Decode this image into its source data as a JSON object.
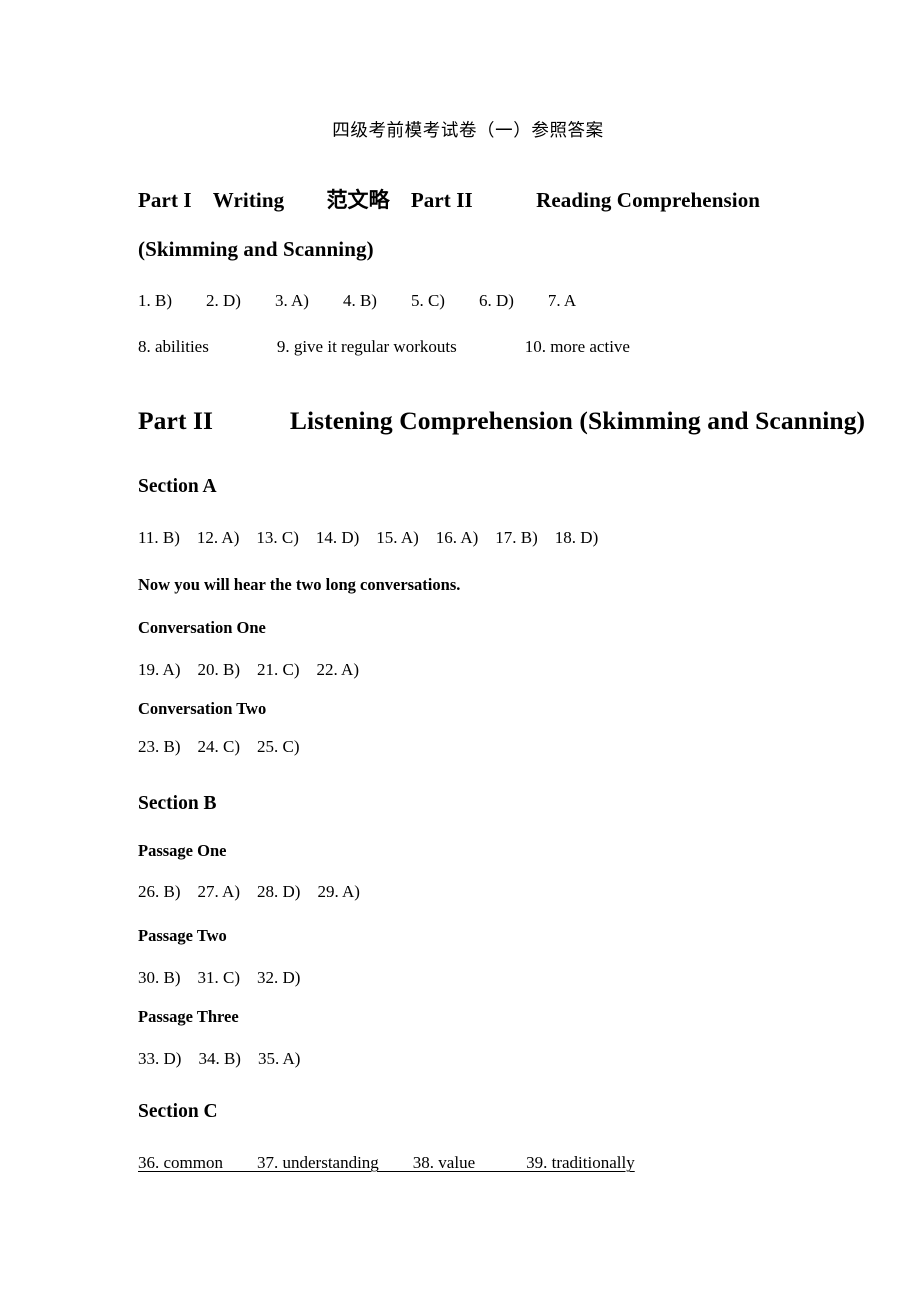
{
  "document": {
    "title": "四级考前模考试卷（一）参照答案"
  },
  "part_one": {
    "heading": "Part I　Writing　　范文略　Part II　　　Reading Comprehension (Skimming and Scanning)",
    "answers_line_1": "1. B)　　2. D)　　3. A)　　4. B)　　5. C)　　6. D)　　7. A",
    "answers_line_2": "8. abilities　　　　9. give it regular workouts　　　　10. more active"
  },
  "part_two": {
    "heading": "Part II　　　Listening Comprehension (Skimming and Scanning)",
    "section_a": {
      "heading": "Section A",
      "answers": "11. B)　12. A)　13. C)　14. D)　15. A)　16. A)　17. B)　18. D)",
      "note": "Now you will hear the two long conversations.",
      "conversation_one_label": "Conversation One",
      "conversation_one_answers": "19. A)　20. B)　21. C)　22. A)",
      "conversation_two_label": "Conversation Two",
      "conversation_two_answers": "23. B)　24. C)　25. C)"
    },
    "section_b": {
      "heading": "Section B",
      "passage_one_label": "Passage One",
      "passage_one_answers": "26. B)　27. A)　28. D)　29. A)",
      "passage_two_label": "Passage Two",
      "passage_two_answers": "30. B)　31. C)　32. D)",
      "passage_three_label": "Passage Three",
      "passage_three_answers": "33. D)　34. B)　35. A)"
    },
    "section_c": {
      "heading": "Section C",
      "answers": "36. common　　37. understanding　　38. value　　　39. traditionally"
    }
  }
}
